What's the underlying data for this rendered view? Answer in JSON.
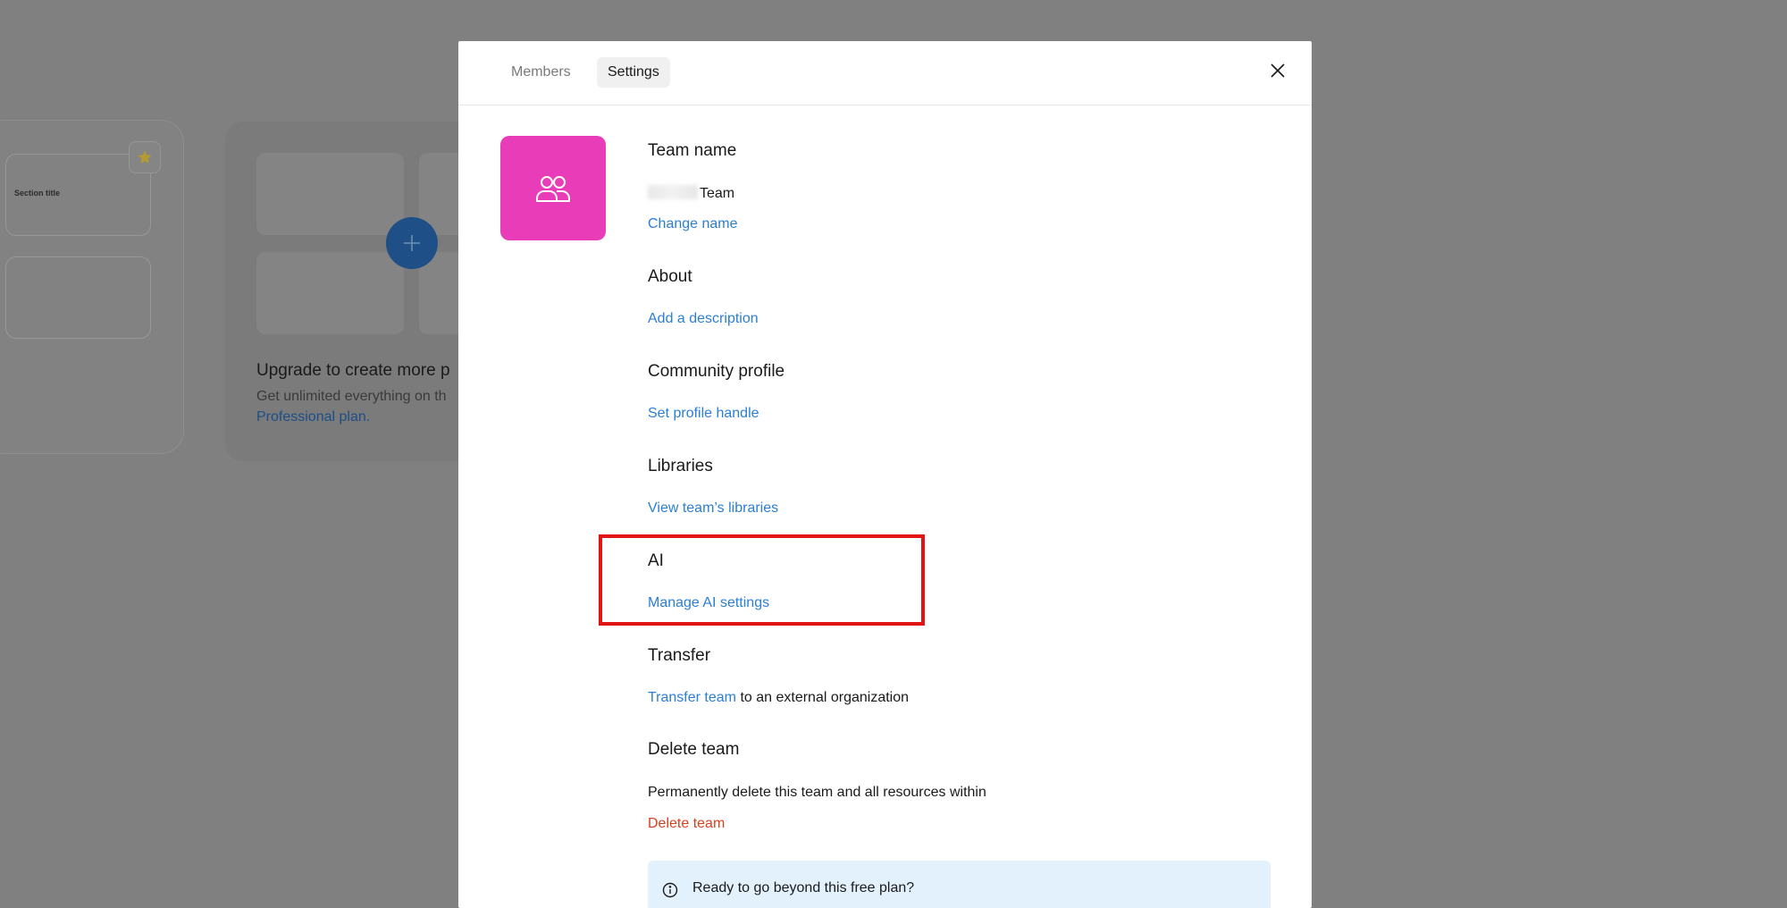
{
  "background": {
    "thumb_title": "Section title",
    "upgrade_title": "Upgrade to create more p",
    "upgrade_sub": "Get unlimited everything on th",
    "upgrade_link": "Professional plan.",
    "colors": {
      "plus_button": "#1e4f86",
      "star": "#d4b53a"
    }
  },
  "modal": {
    "tabs": {
      "members": "Members",
      "settings": "Settings"
    },
    "avatar": {
      "color": "#e93cb8",
      "icon": "team-icon"
    },
    "team_name": {
      "heading": "Team name",
      "value": "Team",
      "action": "Change name"
    },
    "about": {
      "heading": "About",
      "action": "Add a description"
    },
    "community": {
      "heading": "Community profile",
      "action": "Set profile handle"
    },
    "libraries": {
      "heading": "Libraries",
      "action": "View team’s libraries"
    },
    "ai": {
      "heading": "AI",
      "action": "Manage AI settings"
    },
    "transfer": {
      "heading": "Transfer",
      "action": "Transfer team",
      "suffix": " to an external organization"
    },
    "delete": {
      "heading": "Delete team",
      "description": "Permanently delete this team and all resources within",
      "action": "Delete team"
    },
    "info": {
      "text": "Ready to go beyond this free plan?"
    },
    "colors": {
      "link": "#2a7fd4",
      "danger": "#d9401f",
      "info_bg": "#e3f1fc"
    }
  }
}
